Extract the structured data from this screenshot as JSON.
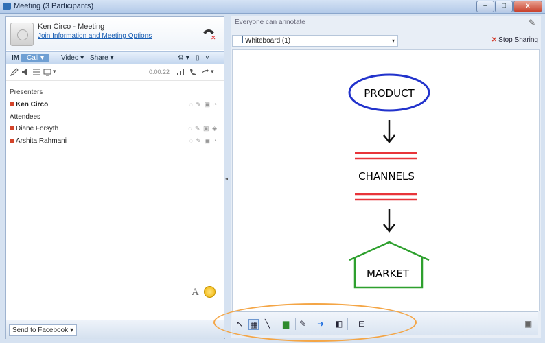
{
  "window": {
    "title": "Meeting (3 Participants)",
    "minimize": "–",
    "maximize": "□",
    "close": "x"
  },
  "contact": {
    "name": "Ken Circo - Meeting",
    "link": "Join Information and Meeting Options"
  },
  "controls": {
    "im": "IM",
    "call": "Call ▾",
    "video": "Video ▾",
    "share": "Share ▾",
    "r1": "⚙ ▾",
    "r2": "▯",
    "r3": "˅"
  },
  "icon_row": {
    "status_text": "0:00:22"
  },
  "participants": {
    "presenters_label": "Presenters",
    "attendees_label": "Attendees",
    "presenters": [
      {
        "name": "Ken Circo",
        "status": "◌ ✎ ▣ ◔"
      }
    ],
    "attendees": [
      {
        "name": "Diane Forsyth",
        "status": "◌ ✎ ▣ ◈"
      },
      {
        "name": "Arshita Rahmani",
        "status": "◌ ✎ ▣ ◔"
      }
    ]
  },
  "compose": {
    "font_label": "A"
  },
  "bottom": {
    "send_label": "Send to Facebook ▾"
  },
  "right": {
    "presenter_label": "Everyone can annotate",
    "whiteboard_select": "Whiteboard (1)",
    "stop_sharing": "Stop Sharing",
    "stop_icon": "✕"
  },
  "whiteboard": {
    "product": "PRODUCT",
    "channels": "CHANNELS",
    "market": "MARKET"
  },
  "draw_tools": [
    {
      "name": "select-tool",
      "glyph": "↖"
    },
    {
      "name": "marquee-tool",
      "glyph": "▦"
    },
    {
      "name": "line-tool",
      "glyph": "╲"
    },
    {
      "name": "highlighter-tool",
      "glyph": "▆"
    },
    {
      "name": "pen-tool",
      "glyph": "✎"
    },
    {
      "name": "arrow-tool",
      "glyph": "➜"
    },
    {
      "name": "eraser-tool",
      "glyph": "◧"
    },
    {
      "name": "more-tool",
      "glyph": "⊟"
    }
  ],
  "colors": {
    "product_circle": "#2233cc",
    "channels_lines": "#e8343a",
    "market_house": "#2ea02e",
    "highlight": "#f4a545"
  }
}
